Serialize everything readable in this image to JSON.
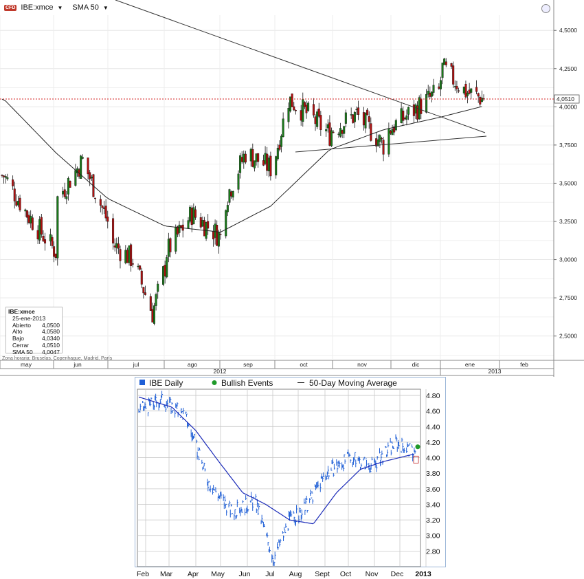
{
  "top_chart": {
    "cfd_badge": "CFD",
    "symbol_menu": "IBE:xmce",
    "indicator_menu": "SMA 50",
    "info": {
      "title": "IBE:xmce",
      "date": "25-ene-2013",
      "rows": [
        {
          "label": "Abierto",
          "value": "4,0500"
        },
        {
          "label": "Alto",
          "value": "4,0580"
        },
        {
          "label": "Bajo",
          "value": "4,0340"
        },
        {
          "label": "Cerrar",
          "value": "4,0510"
        },
        {
          "label": "SMA 50",
          "value": "4,0047"
        }
      ]
    },
    "timezone_note": "Zona horaria: Bruselas, Copenhague, Madrid, París",
    "last_price_label": "4,0510",
    "colors": {
      "up": "#1a7a1a",
      "down": "#b01010",
      "sma": "#222222",
      "price_line": "#d62020",
      "trend": "#333333"
    }
  },
  "chart_data": [
    {
      "type": "candlestick",
      "title": "",
      "series": [
        {
          "name": "IBE:xmce",
          "x": [
            "2012-05-02",
            "2012-05-15",
            "2012-05-31",
            "2012-06-01",
            "2012-06-15",
            "2012-06-29",
            "2012-07-02",
            "2012-07-13",
            "2012-07-24",
            "2012-07-31",
            "2012-08-01",
            "2012-08-15",
            "2012-08-31",
            "2012-09-03",
            "2012-09-14",
            "2012-09-28",
            "2012-10-01",
            "2012-10-08",
            "2012-10-19",
            "2012-10-31",
            "2012-11-01",
            "2012-11-15",
            "2012-11-30",
            "2012-12-03",
            "2012-12-14",
            "2012-12-31",
            "2013-01-02",
            "2013-01-15",
            "2013-01-25"
          ],
          "close": [
            3.55,
            3.3,
            3.05,
            3.4,
            3.65,
            3.25,
            3.1,
            3.0,
            2.65,
            2.95,
            3.05,
            3.3,
            3.15,
            3.4,
            3.7,
            3.6,
            3.7,
            4.05,
            3.95,
            3.82,
            3.85,
            3.95,
            3.75,
            3.85,
            3.95,
            4.1,
            4.25,
            4.1,
            4.051
          ]
        },
        {
          "name": "SMA 50",
          "x": [
            "2012-05-02",
            "2012-05-31",
            "2012-06-29",
            "2012-07-31",
            "2012-08-31",
            "2012-09-28",
            "2012-10-31",
            "2012-11-30",
            "2012-12-31",
            "2013-01-25"
          ],
          "values": [
            4.05,
            3.7,
            3.4,
            3.22,
            3.18,
            3.35,
            3.72,
            3.85,
            3.93,
            4.0047
          ]
        }
      ],
      "last_value": "4,0510",
      "y_ticks": [
        "4,5000",
        "4,2500",
        "4,0000",
        "3,7500",
        "3,5000",
        "3,2500",
        "3,0000",
        "2,7500",
        "2,5000"
      ],
      "ylim": [
        2.35,
        4.6
      ],
      "x_month_labels": [
        "may",
        "jun",
        "jul",
        "ago",
        "sep",
        "oct",
        "nov",
        "dic",
        "ene",
        "feb"
      ],
      "x_year_labels": [
        "2012",
        "2013"
      ],
      "grid": true
    },
    {
      "type": "line",
      "legend": [
        "IBE Daily",
        "Bullish Events",
        "50-Day Moving Average"
      ],
      "legend_placement": "top",
      "series": [
        {
          "name": "IBE Daily",
          "x": [
            "2012-02-01",
            "2012-03-01",
            "2012-04-01",
            "2012-05-01",
            "2012-06-01",
            "2012-07-01",
            "2012-07-25",
            "2012-08-15",
            "2012-09-01",
            "2012-10-01",
            "2012-11-01",
            "2012-12-01",
            "2013-01-01",
            "2013-01-25"
          ],
          "values": [
            4.6,
            4.75,
            4.55,
            3.7,
            3.3,
            3.45,
            2.7,
            3.2,
            3.3,
            3.8,
            4.0,
            3.9,
            4.2,
            4.05
          ]
        },
        {
          "name": "50-Day Moving Average",
          "x": [
            "2012-02-01",
            "2012-03-15",
            "2012-04-15",
            "2012-05-15",
            "2012-06-15",
            "2012-07-15",
            "2012-08-15",
            "2012-09-15",
            "2012-10-15",
            "2012-11-15",
            "2012-12-15",
            "2013-01-25"
          ],
          "values": [
            4.78,
            4.65,
            4.35,
            3.95,
            3.55,
            3.4,
            3.2,
            3.15,
            3.55,
            3.85,
            3.95,
            4.05
          ]
        }
      ],
      "bullish_events": [
        {
          "x": "2013-01-25",
          "value": 4.14
        }
      ],
      "y_ticks": [
        "4.80",
        "4.60",
        "4.40",
        "4.20",
        "4.00",
        "3.80",
        "3.60",
        "3.40",
        "3.20",
        "3.00",
        "2.80"
      ],
      "ylim": [
        2.6,
        4.88
      ],
      "x_labels": [
        "Feb",
        "Mar",
        "Apr",
        "May",
        "Jun",
        "Jul",
        "Aug",
        "Sept",
        "Oct",
        "Nov",
        "Dec",
        "2013"
      ],
      "colors": {
        "price": "#1f5fd6",
        "sma": "#1a2ab8",
        "bullish": "#1f9a2a",
        "grid": "#c8c8c8"
      },
      "grid": true
    }
  ]
}
